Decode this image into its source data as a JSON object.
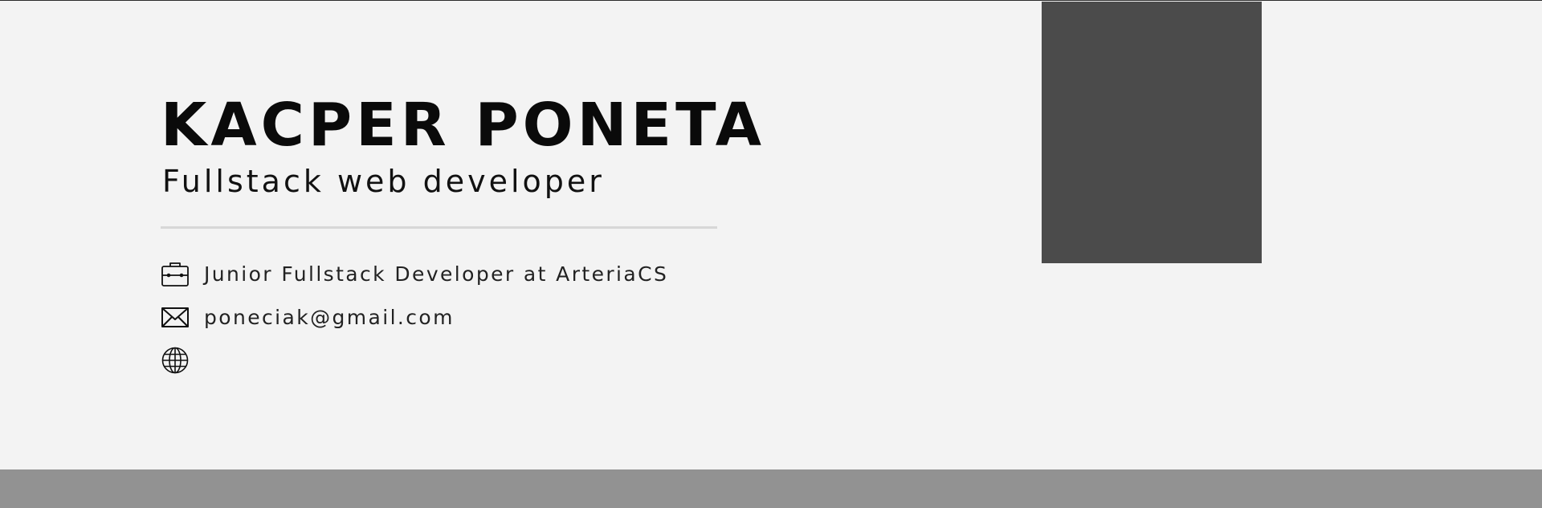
{
  "profile": {
    "name": "KACPER PONETA",
    "title": "Fullstack web developer"
  },
  "contacts": {
    "job": {
      "icon": "briefcase-icon",
      "text": "Junior Fullstack Developer at ArteriaCS"
    },
    "email": {
      "icon": "envelope-icon",
      "text": "poneciak@gmail.com"
    },
    "website": {
      "icon": "globe-icon",
      "text": ""
    }
  },
  "colors": {
    "background": "#f3f3f3",
    "photo_placeholder": "#4b4b4b",
    "footer_band": "#929292",
    "divider": "#d7d7d7",
    "text_primary": "#0a0a0a"
  }
}
